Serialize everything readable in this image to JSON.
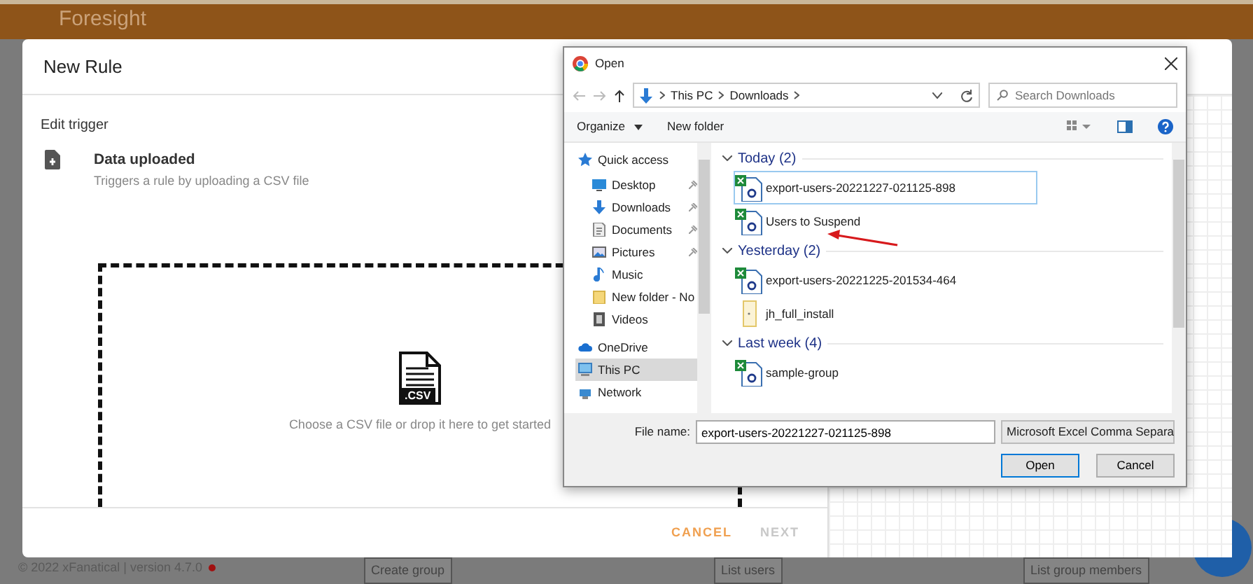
{
  "app": {
    "title": "Foresight",
    "footer": "© 2022 xFanatical | version 4.7.0",
    "footer_buttons": [
      "Create group",
      "List users",
      "List group members"
    ]
  },
  "modal": {
    "title": "New Rule",
    "section": "Edit trigger",
    "trigger": {
      "name": "Data uploaded",
      "description": "Triggers a rule by uploading a CSV file"
    },
    "dropzone": {
      "badge": ".CSV",
      "text": "Choose a CSV file or drop it here to get started"
    },
    "buttons": [
      {
        "label": "CANCEL",
        "disabled": false
      },
      {
        "label": "NEXT",
        "disabled": true
      }
    ]
  },
  "open_dialog": {
    "title": "Open",
    "path": [
      "This PC",
      "Downloads"
    ],
    "search": {
      "placeholder": "Search Downloads"
    },
    "toolbar": [
      "Organize",
      "New folder"
    ],
    "nav": [
      {
        "label": "Quick access",
        "kind": "star",
        "pinned": false,
        "selected": false
      },
      {
        "label": "Desktop",
        "kind": "desktop",
        "pinned": true,
        "selected": false
      },
      {
        "label": "Downloads",
        "kind": "download",
        "pinned": true,
        "selected": false
      },
      {
        "label": "Documents",
        "kind": "document",
        "pinned": true,
        "selected": false
      },
      {
        "label": "Pictures",
        "kind": "picture",
        "pinned": true,
        "selected": false
      },
      {
        "label": "Music",
        "kind": "music",
        "pinned": false,
        "selected": false
      },
      {
        "label": "New folder - No",
        "kind": "folder",
        "pinned": false,
        "selected": false
      },
      {
        "label": "Videos",
        "kind": "video",
        "pinned": false,
        "selected": false
      },
      {
        "label": "OneDrive",
        "kind": "cloud",
        "pinned": false,
        "selected": false
      },
      {
        "label": "This PC",
        "kind": "computer",
        "pinned": false,
        "selected": true
      },
      {
        "label": "Network",
        "kind": "network",
        "pinned": false,
        "selected": false
      }
    ],
    "groups": [
      {
        "label": "Today (2)",
        "files": [
          {
            "name": "export-users-20221227-021125-898",
            "kind": "excel",
            "selected": true
          },
          {
            "name": "Users to Suspend",
            "kind": "excel",
            "selected": false
          }
        ]
      },
      {
        "label": "Yesterday (2)",
        "files": [
          {
            "name": "export-users-20221225-201534-464",
            "kind": "excel",
            "selected": false
          },
          {
            "name": "jh_full_install",
            "kind": "file",
            "selected": false
          }
        ]
      },
      {
        "label": "Last week (4)",
        "files": [
          {
            "name": "sample-group",
            "kind": "excel",
            "selected": false
          }
        ]
      }
    ],
    "file_name_label": "File name:",
    "file_name": "export-users-20221227-021125-898",
    "file_type": "Microsoft Excel Comma Separa",
    "buttons": [
      "Open",
      "Cancel"
    ]
  }
}
